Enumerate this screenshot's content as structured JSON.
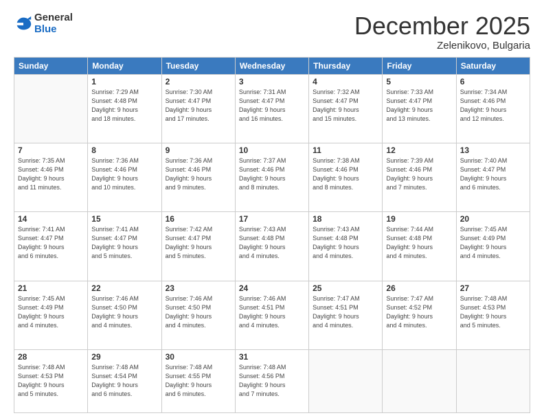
{
  "logo": {
    "general": "General",
    "blue": "Blue"
  },
  "header": {
    "month": "December 2025",
    "location": "Zelenikovo, Bulgaria"
  },
  "days_of_week": [
    "Sunday",
    "Monday",
    "Tuesday",
    "Wednesday",
    "Thursday",
    "Friday",
    "Saturday"
  ],
  "weeks": [
    [
      {
        "day": "",
        "info": ""
      },
      {
        "day": "1",
        "info": "Sunrise: 7:29 AM\nSunset: 4:48 PM\nDaylight: 9 hours\nand 18 minutes."
      },
      {
        "day": "2",
        "info": "Sunrise: 7:30 AM\nSunset: 4:47 PM\nDaylight: 9 hours\nand 17 minutes."
      },
      {
        "day": "3",
        "info": "Sunrise: 7:31 AM\nSunset: 4:47 PM\nDaylight: 9 hours\nand 16 minutes."
      },
      {
        "day": "4",
        "info": "Sunrise: 7:32 AM\nSunset: 4:47 PM\nDaylight: 9 hours\nand 15 minutes."
      },
      {
        "day": "5",
        "info": "Sunrise: 7:33 AM\nSunset: 4:47 PM\nDaylight: 9 hours\nand 13 minutes."
      },
      {
        "day": "6",
        "info": "Sunrise: 7:34 AM\nSunset: 4:46 PM\nDaylight: 9 hours\nand 12 minutes."
      }
    ],
    [
      {
        "day": "7",
        "info": "Sunrise: 7:35 AM\nSunset: 4:46 PM\nDaylight: 9 hours\nand 11 minutes."
      },
      {
        "day": "8",
        "info": "Sunrise: 7:36 AM\nSunset: 4:46 PM\nDaylight: 9 hours\nand 10 minutes."
      },
      {
        "day": "9",
        "info": "Sunrise: 7:36 AM\nSunset: 4:46 PM\nDaylight: 9 hours\nand 9 minutes."
      },
      {
        "day": "10",
        "info": "Sunrise: 7:37 AM\nSunset: 4:46 PM\nDaylight: 9 hours\nand 8 minutes."
      },
      {
        "day": "11",
        "info": "Sunrise: 7:38 AM\nSunset: 4:46 PM\nDaylight: 9 hours\nand 8 minutes."
      },
      {
        "day": "12",
        "info": "Sunrise: 7:39 AM\nSunset: 4:46 PM\nDaylight: 9 hours\nand 7 minutes."
      },
      {
        "day": "13",
        "info": "Sunrise: 7:40 AM\nSunset: 4:47 PM\nDaylight: 9 hours\nand 6 minutes."
      }
    ],
    [
      {
        "day": "14",
        "info": "Sunrise: 7:41 AM\nSunset: 4:47 PM\nDaylight: 9 hours\nand 6 minutes."
      },
      {
        "day": "15",
        "info": "Sunrise: 7:41 AM\nSunset: 4:47 PM\nDaylight: 9 hours\nand 5 minutes."
      },
      {
        "day": "16",
        "info": "Sunrise: 7:42 AM\nSunset: 4:47 PM\nDaylight: 9 hours\nand 5 minutes."
      },
      {
        "day": "17",
        "info": "Sunrise: 7:43 AM\nSunset: 4:48 PM\nDaylight: 9 hours\nand 4 minutes."
      },
      {
        "day": "18",
        "info": "Sunrise: 7:43 AM\nSunset: 4:48 PM\nDaylight: 9 hours\nand 4 minutes."
      },
      {
        "day": "19",
        "info": "Sunrise: 7:44 AM\nSunset: 4:48 PM\nDaylight: 9 hours\nand 4 minutes."
      },
      {
        "day": "20",
        "info": "Sunrise: 7:45 AM\nSunset: 4:49 PM\nDaylight: 9 hours\nand 4 minutes."
      }
    ],
    [
      {
        "day": "21",
        "info": "Sunrise: 7:45 AM\nSunset: 4:49 PM\nDaylight: 9 hours\nand 4 minutes."
      },
      {
        "day": "22",
        "info": "Sunrise: 7:46 AM\nSunset: 4:50 PM\nDaylight: 9 hours\nand 4 minutes."
      },
      {
        "day": "23",
        "info": "Sunrise: 7:46 AM\nSunset: 4:50 PM\nDaylight: 9 hours\nand 4 minutes."
      },
      {
        "day": "24",
        "info": "Sunrise: 7:46 AM\nSunset: 4:51 PM\nDaylight: 9 hours\nand 4 minutes."
      },
      {
        "day": "25",
        "info": "Sunrise: 7:47 AM\nSunset: 4:51 PM\nDaylight: 9 hours\nand 4 minutes."
      },
      {
        "day": "26",
        "info": "Sunrise: 7:47 AM\nSunset: 4:52 PM\nDaylight: 9 hours\nand 4 minutes."
      },
      {
        "day": "27",
        "info": "Sunrise: 7:48 AM\nSunset: 4:53 PM\nDaylight: 9 hours\nand 5 minutes."
      }
    ],
    [
      {
        "day": "28",
        "info": "Sunrise: 7:48 AM\nSunset: 4:53 PM\nDaylight: 9 hours\nand 5 minutes."
      },
      {
        "day": "29",
        "info": "Sunrise: 7:48 AM\nSunset: 4:54 PM\nDaylight: 9 hours\nand 6 minutes."
      },
      {
        "day": "30",
        "info": "Sunrise: 7:48 AM\nSunset: 4:55 PM\nDaylight: 9 hours\nand 6 minutes."
      },
      {
        "day": "31",
        "info": "Sunrise: 7:48 AM\nSunset: 4:56 PM\nDaylight: 9 hours\nand 7 minutes."
      },
      {
        "day": "",
        "info": ""
      },
      {
        "day": "",
        "info": ""
      },
      {
        "day": "",
        "info": ""
      }
    ]
  ]
}
